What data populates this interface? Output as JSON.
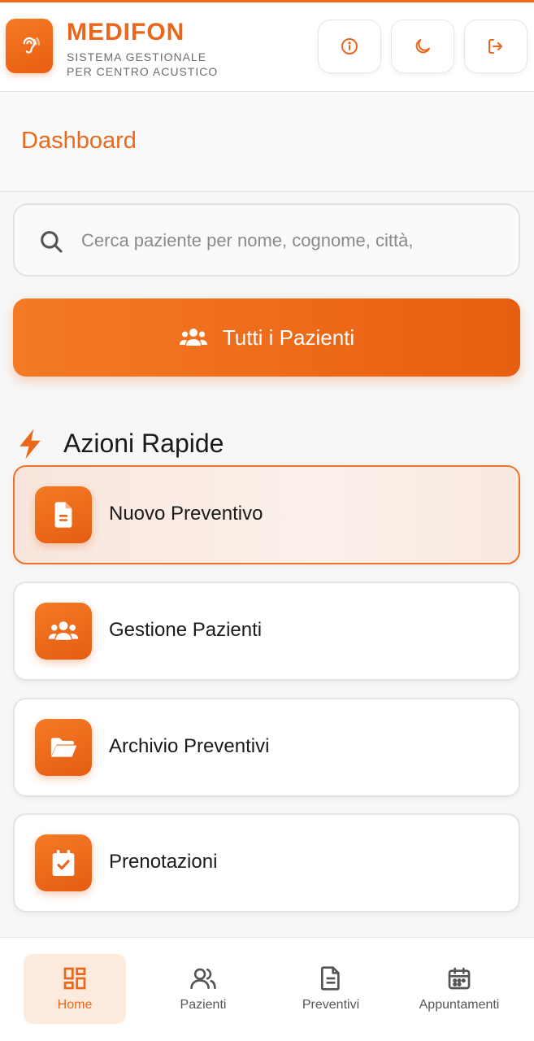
{
  "header": {
    "brand": "MEDIFON",
    "subtitle_line1": "SISTEMA GESTIONALE",
    "subtitle_line2": "PER CENTRO ACUSTICO",
    "logo_icon": "ear-icon",
    "buttons": [
      {
        "name": "info",
        "icon": "info-icon"
      },
      {
        "name": "theme",
        "icon": "moon-icon"
      },
      {
        "name": "logout",
        "icon": "logout-icon"
      }
    ]
  },
  "page": {
    "title": "Dashboard"
  },
  "search": {
    "placeholder": "Cerca paziente per nome, cognome, città,",
    "value": ""
  },
  "primary_button": {
    "label": "Tutti i Pazienti",
    "icon": "users-icon"
  },
  "quick_actions": {
    "title": "Azioni Rapide",
    "icon": "bolt-icon",
    "items": [
      {
        "label": "Nuovo Preventivo",
        "icon": "file-icon",
        "active": true
      },
      {
        "label": "Gestione Pazienti",
        "icon": "users-icon",
        "active": false
      },
      {
        "label": "Archivio Preventivi",
        "icon": "folder-open-icon",
        "active": false
      },
      {
        "label": "Prenotazioni",
        "icon": "calendar-check-icon",
        "active": false
      }
    ]
  },
  "bottom_nav": {
    "items": [
      {
        "label": "Home",
        "icon": "grid-icon",
        "active": true
      },
      {
        "label": "Pazienti",
        "icon": "users-outline-icon",
        "active": false
      },
      {
        "label": "Preventivi",
        "icon": "document-icon",
        "active": false
      },
      {
        "label": "Appuntamenti",
        "icon": "calendar-icon",
        "active": false
      }
    ]
  },
  "colors": {
    "accent": "#ea661b",
    "accent_dark": "#e85e12",
    "active_bg": "#fcebdc"
  }
}
